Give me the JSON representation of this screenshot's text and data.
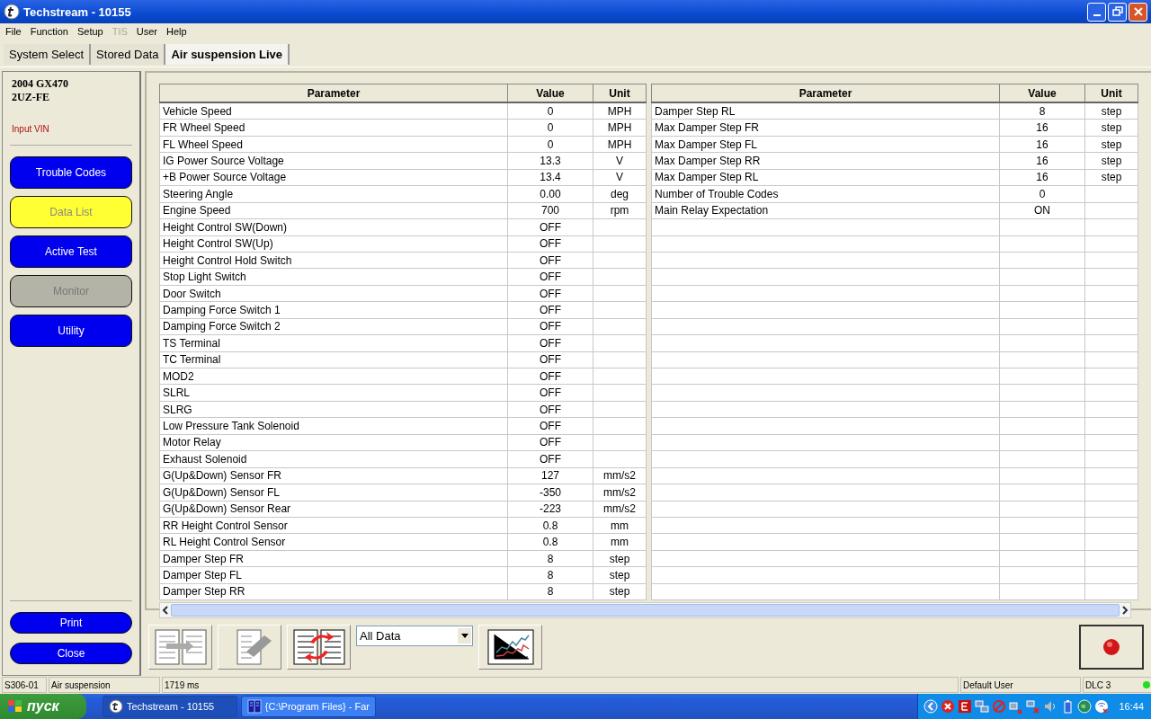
{
  "window": {
    "title": "Techstream - 10155"
  },
  "menu": [
    {
      "label": "File",
      "disabled": false
    },
    {
      "label": "Function",
      "disabled": false
    },
    {
      "label": "Setup",
      "disabled": false
    },
    {
      "label": "TIS",
      "disabled": true
    },
    {
      "label": "User",
      "disabled": false
    },
    {
      "label": "Help",
      "disabled": false
    }
  ],
  "tabs": [
    {
      "label": "System Select",
      "selected": false
    },
    {
      "label": "Stored Data",
      "selected": false
    },
    {
      "label": "Air suspension Live",
      "selected": true
    }
  ],
  "vehicle": {
    "model": "2004  GX470",
    "engine": "2UZ-FE",
    "vin_link": "Input VIN"
  },
  "nav_buttons": [
    {
      "label": "Trouble Codes",
      "selected": false,
      "disabled": false
    },
    {
      "label": "Data List",
      "selected": true,
      "disabled": false
    },
    {
      "label": "Active Test",
      "selected": false,
      "disabled": false
    },
    {
      "label": "Monitor",
      "selected": false,
      "disabled": true
    },
    {
      "label": "Utility",
      "selected": false,
      "disabled": false
    }
  ],
  "bottom_buttons": [
    "Print",
    "Close"
  ],
  "table": {
    "columns": [
      "Parameter",
      "Value",
      "Unit"
    ],
    "left_rows": [
      [
        "Vehicle Speed",
        "0",
        "MPH"
      ],
      [
        "FR Wheel Speed",
        "0",
        "MPH"
      ],
      [
        "FL Wheel Speed",
        "0",
        "MPH"
      ],
      [
        "IG Power Source Voltage",
        "13.3",
        "V"
      ],
      [
        "+B Power Source Voltage",
        "13.4",
        "V"
      ],
      [
        "Steering Angle",
        "0.00",
        "deg"
      ],
      [
        "Engine Speed",
        "700",
        "rpm"
      ],
      [
        "Height Control SW(Down)",
        "OFF",
        ""
      ],
      [
        "Height Control SW(Up)",
        "OFF",
        ""
      ],
      [
        "Height Control Hold Switch",
        "OFF",
        ""
      ],
      [
        "Stop Light Switch",
        "OFF",
        ""
      ],
      [
        "Door Switch",
        "OFF",
        ""
      ],
      [
        "Damping Force Switch 1",
        "OFF",
        ""
      ],
      [
        "Damping Force Switch 2",
        "OFF",
        ""
      ],
      [
        "TS Terminal",
        "OFF",
        ""
      ],
      [
        "TC Terminal",
        "OFF",
        ""
      ],
      [
        "MOD2",
        "OFF",
        ""
      ],
      [
        "SLRL",
        "OFF",
        ""
      ],
      [
        "SLRG",
        "OFF",
        ""
      ],
      [
        "Low Pressure Tank Solenoid",
        "OFF",
        ""
      ],
      [
        "Motor Relay",
        "OFF",
        ""
      ],
      [
        "Exhaust Solenoid",
        "OFF",
        ""
      ],
      [
        "G(Up&Down) Sensor FR",
        "127",
        "mm/s2"
      ],
      [
        "G(Up&Down) Sensor FL",
        "-350",
        "mm/s2"
      ],
      [
        "G(Up&Down) Sensor Rear",
        "-223",
        "mm/s2"
      ],
      [
        "RR Height Control Sensor",
        "0.8",
        "mm"
      ],
      [
        "RL Height Control Sensor",
        "0.8",
        "mm"
      ],
      [
        "Damper Step FR",
        "8",
        "step"
      ],
      [
        "Damper Step FL",
        "8",
        "step"
      ],
      [
        "Damper Step RR",
        "8",
        "step"
      ]
    ],
    "right_columns": [
      "Parameter",
      "Value",
      "Unit"
    ],
    "right_rows": [
      [
        "Damper Step RL",
        "8",
        "step"
      ],
      [
        "Max Damper Step FR",
        "16",
        "step"
      ],
      [
        "Max Damper Step FL",
        "16",
        "step"
      ],
      [
        "Max Damper Step RR",
        "16",
        "step"
      ],
      [
        "Max Damper Step RL",
        "16",
        "step"
      ],
      [
        "Number of Trouble Codes",
        "0",
        ""
      ],
      [
        "Main Relay Expectation",
        "ON",
        ""
      ]
    ]
  },
  "filter": {
    "value": "All Data"
  },
  "status_bar": {
    "code": "S306-01",
    "system": "Air suspension",
    "time": "1719 ms",
    "user": "Default User",
    "connection": "DLC 3",
    "connected": true
  },
  "taskbar": {
    "start": "пуск",
    "tasks": [
      {
        "label": "Techstream - 10155",
        "selected": true,
        "kind": "techstream"
      },
      {
        "label": "{C:\\Program Files} - Far",
        "selected": false,
        "kind": "far"
      }
    ],
    "clock": "16:44"
  }
}
